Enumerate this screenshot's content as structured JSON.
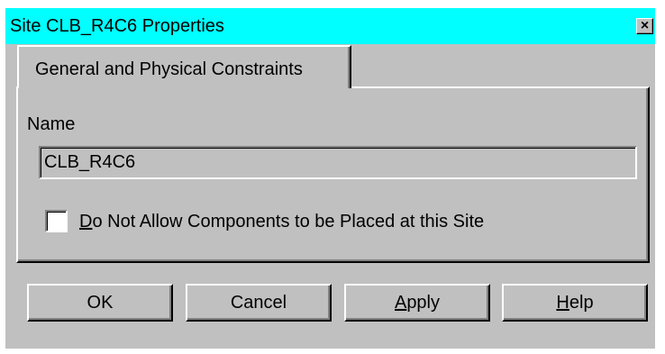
{
  "window": {
    "title": "Site CLB_R4C6 Properties",
    "close_glyph": "×",
    "titlebar_color": "#00ffff"
  },
  "tab": {
    "label": "General and Physical Constraints"
  },
  "name": {
    "label": "Name",
    "value": "CLB_R4C6"
  },
  "checkbox": {
    "label_mnemonic": "D",
    "label_rest": "o Not Allow Components to be Placed at this Site",
    "checked": false
  },
  "buttons": {
    "ok": "OK",
    "cancel": "Cancel",
    "apply_mnemonic": "A",
    "apply_rest": "pply",
    "help_mnemonic": "H",
    "help_rest": "elp"
  }
}
